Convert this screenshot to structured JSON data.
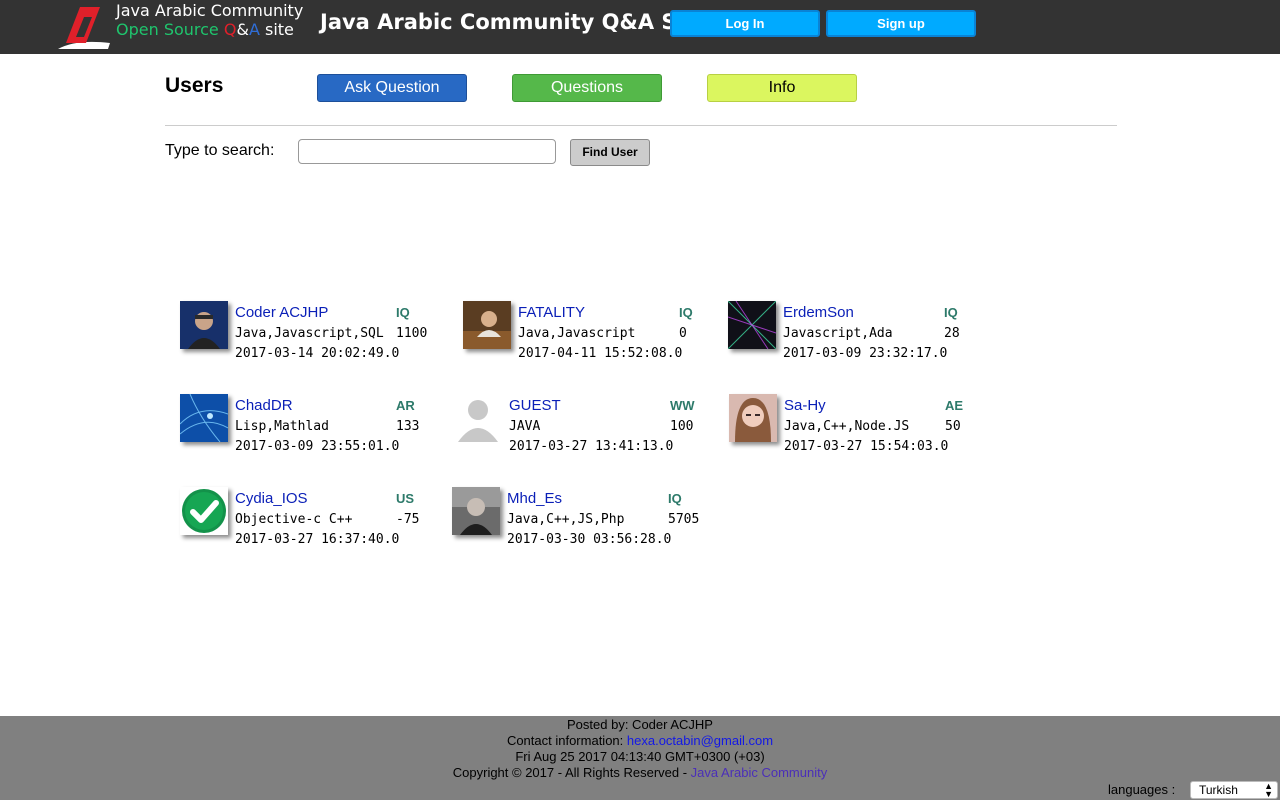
{
  "header": {
    "logo_line1": "Java Arabic Community",
    "logo_line2_a": "Open Source ",
    "logo_line2_q": "Q",
    "logo_line2_amp": "&",
    "logo_line2_A": "A",
    "logo_line2_site": " site",
    "site_title": "Java Arabic Community Q&A Site",
    "login_label": "Log In",
    "signup_label": "Sign up"
  },
  "nav": {
    "page_title": "Users",
    "ask_label": "Ask Question",
    "questions_label": "Questions",
    "info_label": "Info"
  },
  "search": {
    "label": "Type to search:",
    "value": "",
    "button_label": "Find User"
  },
  "users": [
    {
      "name": "Coder ACJHP",
      "country": "IQ",
      "tags": "Java,Javascript,SQL",
      "reputation": "1100",
      "date": "2017-03-14 20:02:49.0"
    },
    {
      "name": "FATALITY",
      "country": "IQ",
      "tags": "Java,Javascript",
      "reputation": "0",
      "date": "2017-04-11 15:52:08.0"
    },
    {
      "name": "ErdemSon",
      "country": "IQ",
      "tags": "Javascript,Ada",
      "reputation": "28",
      "date": "2017-03-09 23:32:17.0"
    },
    {
      "name": "ChadDR",
      "country": "AR",
      "tags": "Lisp,Mathlad",
      "reputation": "133",
      "date": "2017-03-09 23:55:01.0"
    },
    {
      "name": "GUEST",
      "country": "WW",
      "tags": "JAVA",
      "reputation": "100",
      "date": "2017-03-27 13:41:13.0"
    },
    {
      "name": "Sa-Hy",
      "country": "AE",
      "tags": "Java,C++,Node.JS",
      "reputation": "50",
      "date": "2017-03-27 15:54:03.0"
    },
    {
      "name": "Cydia_IOS",
      "country": "US",
      "tags": "Objective-c C++",
      "reputation": "-75",
      "date": "2017-03-27 16:37:40.0"
    },
    {
      "name": "Mhd_Es",
      "country": "IQ",
      "tags": "Java,C++,JS,Php",
      "reputation": "5705",
      "date": "2017-03-30 03:56:28.0"
    }
  ],
  "footer": {
    "posted_by": "Posted by: Coder ACJHP",
    "contact_label": "Contact information: ",
    "contact_email": "hexa.octabin@gmail.com",
    "datetime": "Fri Aug 25 2017 04:13:40 GMT+0300 (+03)",
    "copyright": "Copyright © 2017 - All Rights Reserved - ",
    "community_link": "Java Arabic Community",
    "languages_label": "languages :",
    "language_selected": "Turkish"
  },
  "colors": {
    "header_bg": "#333333",
    "header_button": "#00aaff",
    "ask_button": "#2869c4",
    "questions_button": "#55b84a",
    "info_button": "#dbf65f",
    "user_name": "#0a1fb7",
    "country_code": "#2d7a6a",
    "footer_bg": "#808080"
  }
}
